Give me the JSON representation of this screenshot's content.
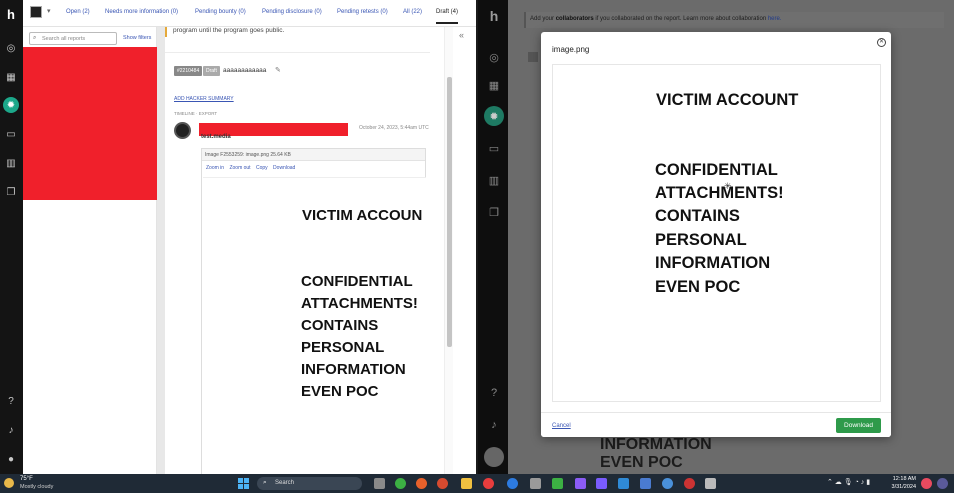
{
  "left_window": {
    "tabs": [
      {
        "label": "Open (2)"
      },
      {
        "label": "Needs more information (0)"
      },
      {
        "label": "Pending bounty (0)"
      },
      {
        "label": "Pending disclosure (0)"
      },
      {
        "label": "Pending retests (0)"
      },
      {
        "label": "All (22)"
      },
      {
        "label": "Draft (4)"
      }
    ],
    "search_placeholder": "Search all reports",
    "show_filters": "Show filters",
    "banner_text": "program until the program goes public.",
    "report": {
      "id_badge": "#2210484",
      "status_badge": "Draft",
      "title": "aaaaaaaaaaaa",
      "add_summary": "ADD HACKER SUMMARY",
      "timeline_label": "TIMELINE · EXPORT",
      "user_name": "test.media",
      "date": "October 24, 2023, 5:44am UTC",
      "attachment_header": "Image F2553259: image.png 25.64 KB",
      "attachment_actions": [
        "Zoom in",
        "Zoom out",
        "Copy",
        "Download"
      ]
    }
  },
  "document_text": {
    "heading": "VICTIM ACCOUNT",
    "lines": [
      "CONFIDENTIAL",
      "ATTACHMENTS!",
      "CONTAINS",
      "PERSONAL",
      "INFORMATION",
      "EVEN POC"
    ]
  },
  "left_preview_heading": "VICTIM ACCOUN",
  "right_window": {
    "collab_prefix": "Add your",
    "collab_bold": "collaborators",
    "collab_mid": "if you collaborated on the report. Learn more about collaboration",
    "collab_link": "here.",
    "bg_text_1": "INFORMATION",
    "bg_text_2": "EVEN POC",
    "modal": {
      "title": "image.png",
      "cancel": "Cancel",
      "download": "Download"
    }
  },
  "taskbar": {
    "weather_temp": "75°F",
    "weather_desc": "Mostly cloudy",
    "search_label": "Search",
    "time": "12:18 AM",
    "date": "3/31/2024"
  },
  "colors": {
    "accent_green": "#1ca88a",
    "redaction": "#f0202b",
    "link": "#3a56b4",
    "download_button": "#2e9a4a"
  }
}
